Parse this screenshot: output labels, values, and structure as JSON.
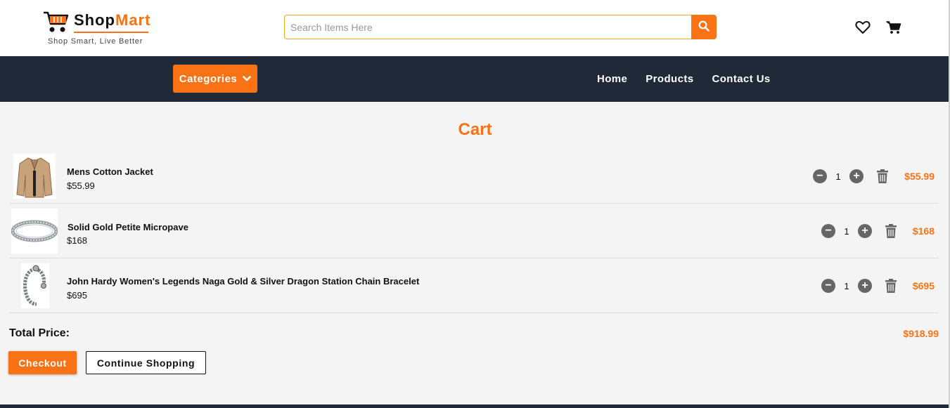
{
  "brand": {
    "name_part1": "Shop",
    "name_part2": "Mart",
    "tagline": "Shop Smart, Live Better",
    "accent_color": "#f97316",
    "logo_icon": "shopping-cart-icon"
  },
  "search": {
    "placeholder": "Search Items Here",
    "value": "",
    "button_icon": "search-icon"
  },
  "header_icons": [
    "heart-icon",
    "cart-icon"
  ],
  "nav": {
    "categories_label": "Categories",
    "links": [
      "Home",
      "Products",
      "Contact Us"
    ],
    "background_color": "#1f2937"
  },
  "cart": {
    "title": "Cart",
    "items": [
      {
        "name": "Mens Cotton Jacket",
        "unit_price": "$55.99",
        "quantity": "1",
        "line_total": "$55.99",
        "thumbnail": "jacket-image"
      },
      {
        "name": "Solid Gold Petite Micropave",
        "unit_price": "$168",
        "quantity": "1",
        "line_total": "$168",
        "thumbnail": "bracelet-image"
      },
      {
        "name": "John Hardy Women's Legends Naga Gold & Silver Dragon Station Chain Bracelet",
        "unit_price": "$695",
        "quantity": "1",
        "line_total": "$695",
        "thumbnail": "dragon-bracelet-image"
      }
    ],
    "total_label": "Total Price:",
    "total_value": "$918.99",
    "checkout_label": "Checkout",
    "continue_label": "Continue Shopping"
  }
}
